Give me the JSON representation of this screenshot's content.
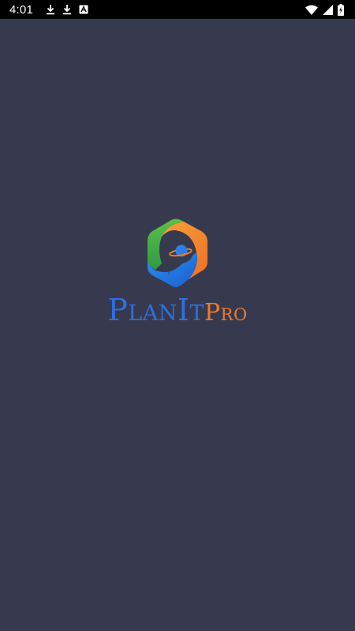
{
  "status_bar": {
    "time": "4:01",
    "left_icons": [
      "download-icon",
      "download-icon",
      "app-notification-icon"
    ],
    "right_icons": [
      "wifi-icon",
      "cell-signal-icon",
      "battery-charging-icon"
    ]
  },
  "splash": {
    "logo_icon": "planitpro-hexagon-logo-icon",
    "wordmark": {
      "part1": "PlanIt",
      "part2": "Pro"
    }
  },
  "colors": {
    "background": "#373a4e",
    "status_bar": "#000000",
    "brand_blue": "#2e6fe0",
    "brand_orange": "#f07a2a",
    "brand_green": "#3fa84a"
  }
}
